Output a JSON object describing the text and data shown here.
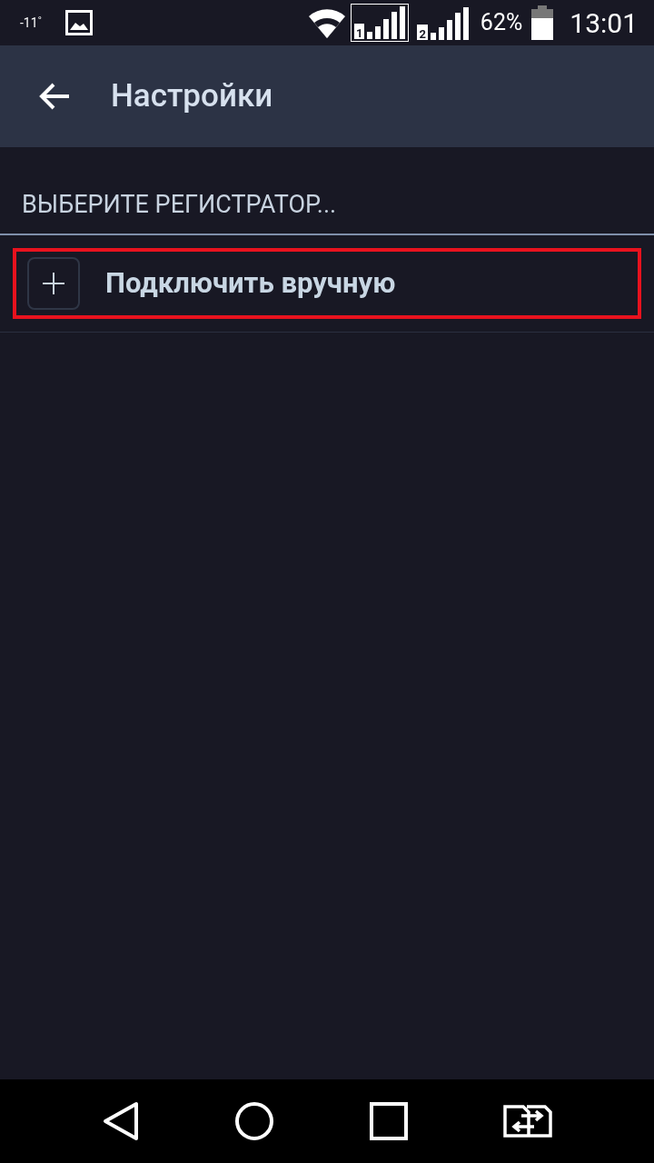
{
  "status_bar": {
    "temperature": "-11˚",
    "sim_1": "1",
    "sim_2": "2",
    "battery_percent": "62%",
    "time": "13:01"
  },
  "app_bar": {
    "title": "Настройки"
  },
  "section": {
    "header": "ВЫБЕРИТЕ РЕГИСТРАТОР...",
    "items": [
      {
        "label": "Подключить вручную",
        "highlighted": true
      }
    ]
  }
}
